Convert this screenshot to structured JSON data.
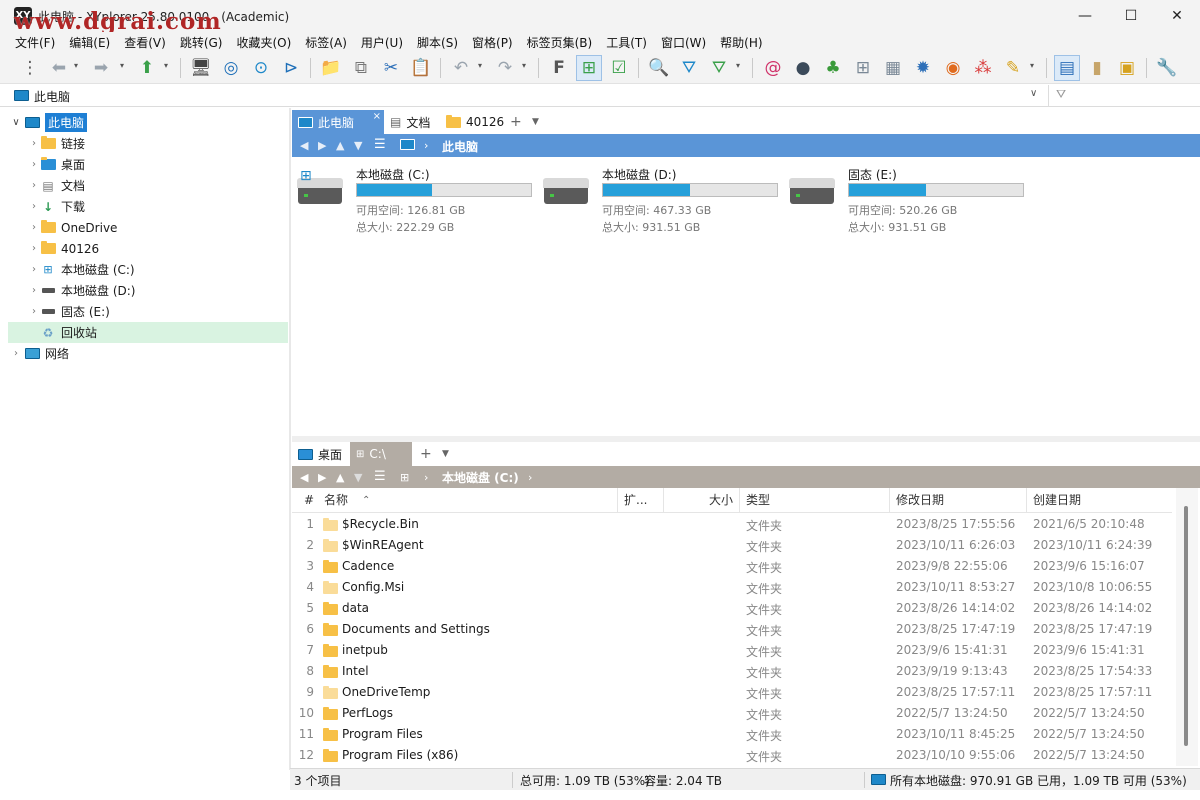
{
  "window": {
    "title": "此电脑 - XYplorer 25.80.0100 - (Academic)",
    "watermark": "www.dgrai.com",
    "app_icon": "XY",
    "minimize": "—",
    "maximize": "☐",
    "close": "✕"
  },
  "menubar": [
    "文件(F)",
    "编辑(E)",
    "查看(V)",
    "跳转(G)",
    "收藏夹(O)",
    "标签(A)",
    "用户(U)",
    "脚本(S)",
    "窗格(P)",
    "标签页集(B)",
    "工具(T)",
    "窗口(W)",
    "帮助(H)"
  ],
  "address": {
    "text": "此电脑"
  },
  "tree": [
    {
      "label": "此电脑",
      "icon": "monitor",
      "level": 0,
      "expander": "∨",
      "selected": true
    },
    {
      "label": "链接",
      "icon": "folder",
      "level": 1,
      "expander": "›"
    },
    {
      "label": "桌面",
      "icon": "folder-blue",
      "level": 1,
      "expander": "›"
    },
    {
      "label": "文档",
      "icon": "document",
      "level": 1,
      "expander": "›"
    },
    {
      "label": "下载",
      "icon": "download",
      "level": 1,
      "expander": "›"
    },
    {
      "label": "OneDrive",
      "icon": "folder",
      "level": 1,
      "expander": "›"
    },
    {
      "label": "40126",
      "icon": "folder",
      "level": 1,
      "expander": "›"
    },
    {
      "label": "本地磁盘 (C:)",
      "icon": "windows-drive",
      "level": 1,
      "expander": "›"
    },
    {
      "label": "本地磁盘 (D:)",
      "icon": "drive",
      "level": 1,
      "expander": "›"
    },
    {
      "label": "固态 (E:)",
      "icon": "drive",
      "level": 1,
      "expander": "›"
    },
    {
      "label": "回收站",
      "icon": "recycle",
      "level": 1,
      "expander": "",
      "highlight": true
    },
    {
      "label": "网络",
      "icon": "network",
      "level": 0,
      "expander": "›"
    }
  ],
  "pane1": {
    "tabs": [
      "此电脑",
      "文档",
      "40126"
    ],
    "active_tab": 0,
    "breadcrumb": "此电脑",
    "drives": [
      {
        "name": "本地磁盘 (C:)",
        "free": "可用空间: 126.81 GB",
        "total": "总大小: 222.29 GB",
        "used_percent": 43
      },
      {
        "name": "本地磁盘 (D:)",
        "free": "可用空间: 467.33 GB",
        "total": "总大小: 931.51 GB",
        "used_percent": 50
      },
      {
        "name": "固态 (E:)",
        "free": "可用空间: 520.26 GB",
        "total": "总大小: 931.51 GB",
        "used_percent": 44
      }
    ]
  },
  "pane2": {
    "tabs": [
      "桌面",
      "C:\\"
    ],
    "active_tab": 1,
    "breadcrumb": "本地磁盘 (C:)",
    "columns": [
      "#",
      "名称",
      "扩...",
      "大小",
      "类型",
      "修改日期",
      "创建日期"
    ],
    "rows": [
      {
        "n": "1",
        "name": "$Recycle.Bin",
        "type": "文件夹",
        "modified": "2023/8/25 17:55:56",
        "created": "2021/6/5 20:10:48",
        "dim": true
      },
      {
        "n": "2",
        "name": "$WinREAgent",
        "type": "文件夹",
        "modified": "2023/10/11 6:26:03",
        "created": "2023/10/11 6:24:39",
        "dim": true
      },
      {
        "n": "3",
        "name": "Cadence",
        "type": "文件夹",
        "modified": "2023/9/8 22:55:06",
        "created": "2023/9/6 15:16:07"
      },
      {
        "n": "4",
        "name": "Config.Msi",
        "type": "文件夹",
        "modified": "2023/10/11 8:53:27",
        "created": "2023/10/8 10:06:55",
        "dim": true
      },
      {
        "n": "5",
        "name": "data",
        "type": "文件夹",
        "modified": "2023/8/26 14:14:02",
        "created": "2023/8/26 14:14:02"
      },
      {
        "n": "6",
        "name": "Documents and Settings",
        "type": "文件夹",
        "modified": "2023/8/25 17:47:19",
        "created": "2023/8/25 17:47:19",
        "link": true
      },
      {
        "n": "7",
        "name": "inetpub",
        "type": "文件夹",
        "modified": "2023/9/6 15:41:31",
        "created": "2023/9/6 15:41:31"
      },
      {
        "n": "8",
        "name": "Intel",
        "type": "文件夹",
        "modified": "2023/9/19 9:13:43",
        "created": "2023/8/25 17:54:33"
      },
      {
        "n": "9",
        "name": "OneDriveTemp",
        "type": "文件夹",
        "modified": "2023/8/25 17:57:11",
        "created": "2023/8/25 17:57:11",
        "dim": true
      },
      {
        "n": "10",
        "name": "PerfLogs",
        "type": "文件夹",
        "modified": "2022/5/7 13:24:50",
        "created": "2022/5/7 13:24:50"
      },
      {
        "n": "11",
        "name": "Program Files",
        "type": "文件夹",
        "modified": "2023/10/11 8:45:25",
        "created": "2022/5/7 13:24:50"
      },
      {
        "n": "12",
        "name": "Program Files (x86)",
        "type": "文件夹",
        "modified": "2023/10/10 9:55:06",
        "created": "2022/5/7 13:24:50"
      }
    ]
  },
  "status": {
    "items": "3 个项目",
    "total_free": "总可用: 1.09 TB (53%)",
    "capacity": "容量: 2.04 TB",
    "all_drives": "所有本地磁盘: 970.91 GB 已用，1.09 TB 可用 (53%)"
  },
  "colors": {
    "accent": "#1e88c9",
    "pane_active": "#5a95d7",
    "pane_inactive": "#b3aca4",
    "drive_bar": "#26a0da",
    "selection": "#1e7fd4"
  }
}
